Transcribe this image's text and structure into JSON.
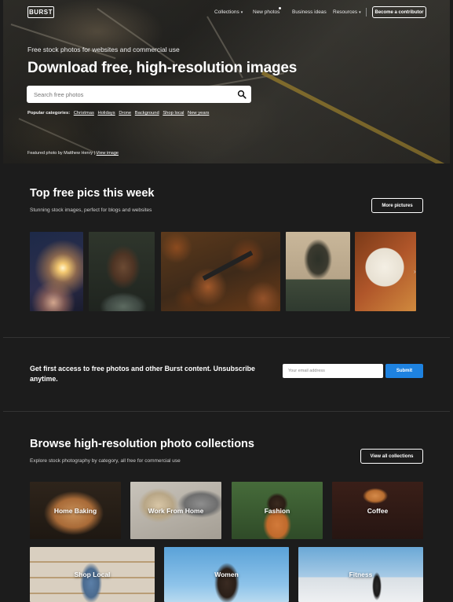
{
  "header": {
    "logo": "BURST",
    "nav": [
      {
        "label": "Collections",
        "has_caret": true
      },
      {
        "label": "New photos",
        "has_caret": false
      },
      {
        "label": "Business ideas",
        "has_caret": false
      },
      {
        "label": "Resources",
        "has_caret": true
      }
    ],
    "contributor_button": "Become a contributor"
  },
  "hero": {
    "subtitle": "Free stock photos for websites and commercial use",
    "title": "Download free, high-resolution images",
    "search_placeholder": "Search free photos",
    "popular_label": "Popular categories:",
    "popular_categories": [
      "Christmas",
      "Holidays",
      "Drone",
      "Background",
      "Shop local",
      "New years"
    ],
    "featured_prefix": "Featured photo by Matthew Henry |",
    "featured_link": "View image"
  },
  "top_pics": {
    "title": "Top free pics this week",
    "subtitle": "Stunning stock images, perfect for blogs and websites",
    "more_button": "More pictures",
    "arrow": "›"
  },
  "newsletter": {
    "text": "Get first access to free photos and other Burst content. Unsubscribe anytime.",
    "email_placeholder": "Your email address",
    "submit": "Submit"
  },
  "collections": {
    "title": "Browse high-resolution photo collections",
    "subtitle": "Explore stock photography by category, all free for commercial use",
    "view_all_button": "View all collections",
    "items": [
      "Home Baking",
      "Work From Home",
      "Fashion",
      "Coffee",
      "Shop Local",
      "Women",
      "Fitness"
    ]
  }
}
